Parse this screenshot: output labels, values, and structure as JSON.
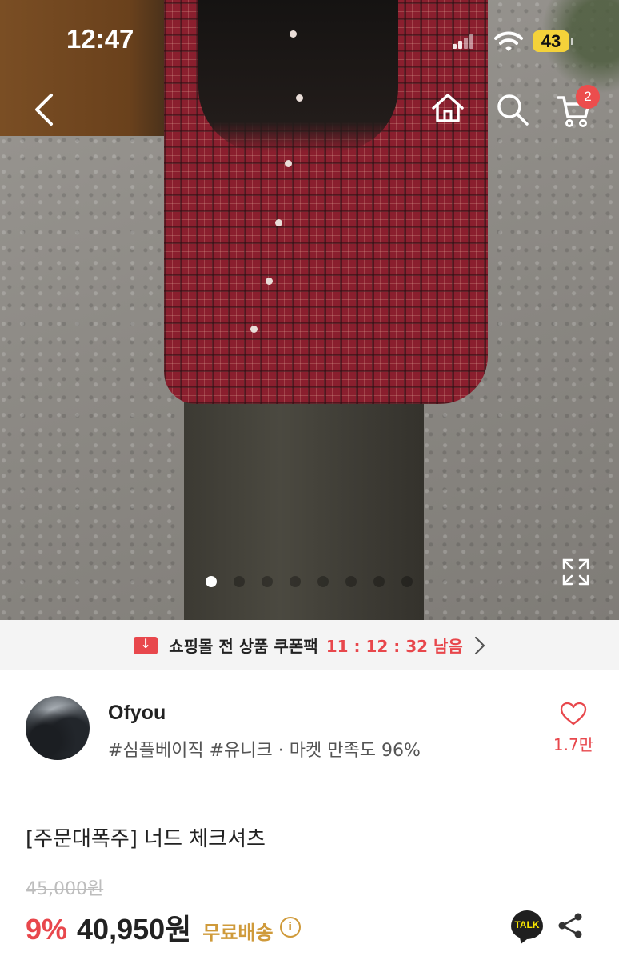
{
  "status_bar": {
    "time": "12:47",
    "battery": "43"
  },
  "nav": {
    "cart_count": "2"
  },
  "carousel": {
    "total": 8,
    "active": 0
  },
  "coupon_banner": {
    "text": "쇼핑몰 전 상품 쿠폰팩",
    "timer": "11 : 12 : 32 남음"
  },
  "shop": {
    "name": "Ofyou",
    "meta": "#심플베이직 #유니크 · 마켓 만족도 96%",
    "like_count": "1.7만"
  },
  "product": {
    "title": "[주문대폭주] 너드 체크셔츠",
    "original_price": "45,000원",
    "discount": "9%",
    "price": "40,950원",
    "shipping": "무료배송"
  },
  "talk_button": {
    "label": "TALK"
  },
  "colors": {
    "accent": "#e8474c",
    "shipping": "#cf9a3a",
    "banner_bg": "#f4f4f4"
  },
  "icons": [
    "back-icon",
    "home-icon",
    "search-icon",
    "cart-icon",
    "expand-icon",
    "coupon-icon",
    "chevron-right-icon",
    "heart-icon",
    "info-icon",
    "share-icon"
  ]
}
